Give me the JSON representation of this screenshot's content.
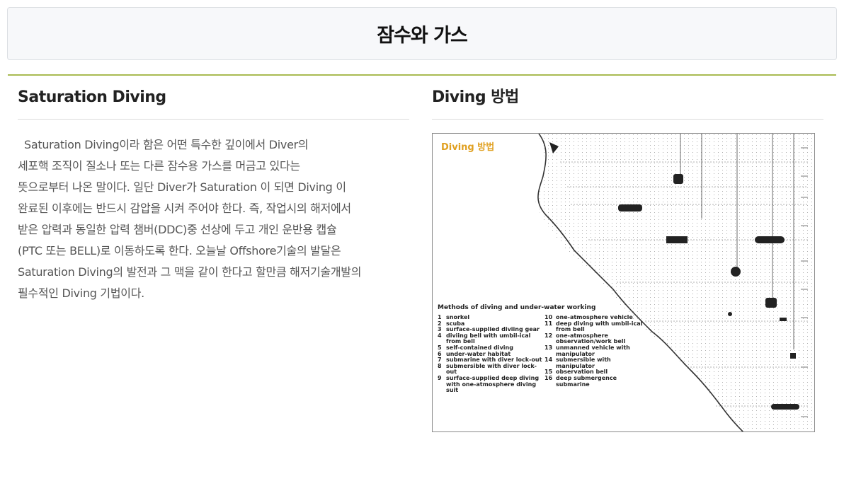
{
  "page": {
    "title": "잠수와 가스"
  },
  "left": {
    "title": "Saturation Diving",
    "lines": [
      "Saturation Diving이라 함은 어떤 특수한 깊이에서 Diver의",
      "세포핵 조직이 질소나 또는 다른 잠수용 가스를 머금고 있다는",
      "뜻으로부터 나온 말이다. 일단 Diver가 Saturation 이 되면 Diving 이",
      "완료된 이후에는 반드시 감압을 시켜 주어야 한다. 즉, 작업시의 해저에서",
      "받은 압력과 동일한 압력 챔버(DDC)중 선상에 두고 개인 운반용 캡슐",
      "(PTC 또는 BELL)로 이동하도록 한다. 오늘날 Offshore기술의 발달은",
      "Saturation Diving의 발전과 그 맥을 같이 한다고 할만큼 해저기술개발의",
      "필수적인 Diving 기법이다."
    ]
  },
  "right": {
    "title": "Diving 방법",
    "figure": {
      "title": "Diving 방법",
      "legend_title": "Methods of diving and under-water working",
      "legend_left": [
        {
          "num": "1",
          "text": "snorkel"
        },
        {
          "num": "2",
          "text": "scuba"
        },
        {
          "num": "3",
          "text": "surface-supplied diviing gear"
        },
        {
          "num": "4",
          "text": "diviing bell with umbil-ical from bell"
        },
        {
          "num": "5",
          "text": "self-contained diving"
        },
        {
          "num": "6",
          "text": "under-water habitat"
        },
        {
          "num": "7",
          "text": "submarine with diver lock-out"
        },
        {
          "num": "8",
          "text": "submersible with diver lock-out"
        },
        {
          "num": "9",
          "text": "surface-supplied deep diving with one-atmosphere diving suit"
        }
      ],
      "legend_right": [
        {
          "num": "10",
          "text": "one-atmosphere vehicle"
        },
        {
          "num": "11",
          "text": "deep diving with umbil-ical from bell"
        },
        {
          "num": "12",
          "text": "one-atmosphere observation/work bell"
        },
        {
          "num": "13",
          "text": "unmanned vehicle with manipulator"
        },
        {
          "num": "14",
          "text": "submersible with manipulator"
        },
        {
          "num": "15",
          "text": "observation bell"
        },
        {
          "num": "16",
          "text": "deep submergence submarine"
        }
      ]
    }
  },
  "colors": {
    "accent_rule": "#a9bb52",
    "figure_title": "#e0a020"
  }
}
